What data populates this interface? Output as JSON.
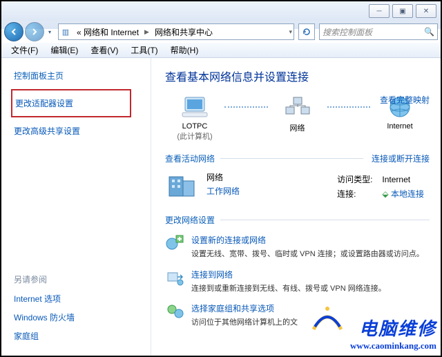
{
  "titlebar": {
    "min": "─",
    "max": "▣",
    "close": "✕"
  },
  "nav": {
    "crumb_icon": "▥",
    "crumb_prev": "« 网络和 Internet",
    "crumb_current": "网络和共享中心",
    "search_placeholder": "搜索控制面板"
  },
  "menu": {
    "file": "文件(F)",
    "edit": "编辑(E)",
    "view": "查看(V)",
    "tools": "工具(T)",
    "help": "帮助(H)"
  },
  "sidebar": {
    "home": "控制面板主页",
    "adapter": "更改适配器设置",
    "advanced": "更改高级共享设置",
    "seealso": "另请参阅",
    "links": {
      "inetopt": "Internet 选项",
      "firewall": "Windows 防火墙",
      "homegroup": "家庭组"
    }
  },
  "page": {
    "title": "查看基本网络信息并设置连接",
    "map_link": "查看完整映射",
    "node_local": "LOTPC",
    "node_local_sub": "(此计算机)",
    "node_network": "网络",
    "node_internet": "Internet",
    "active_hdr": "查看活动网络",
    "active_link": "连接或断开连接",
    "net_name": "网络",
    "net_cat": "工作网络",
    "access_label": "访问类型:",
    "access_value": "Internet",
    "conn_label": "连接:",
    "conn_value": "本地连接",
    "change_hdr": "更改网络设置",
    "opts": [
      {
        "title": "设置新的连接或网络",
        "desc": "设置无线、宽带、拨号、临时或 VPN 连接；或设置路由器或访问点。"
      },
      {
        "title": "连接到网络",
        "desc": "连接到或重新连接到无线、有线、拨号或 VPN 网络连接。"
      },
      {
        "title": "选择家庭组和共享选项",
        "desc": "访问位于其他网络计算机上的文"
      }
    ]
  },
  "watermark": {
    "text": "电脑维修",
    "url": "www.caominkang.com"
  }
}
